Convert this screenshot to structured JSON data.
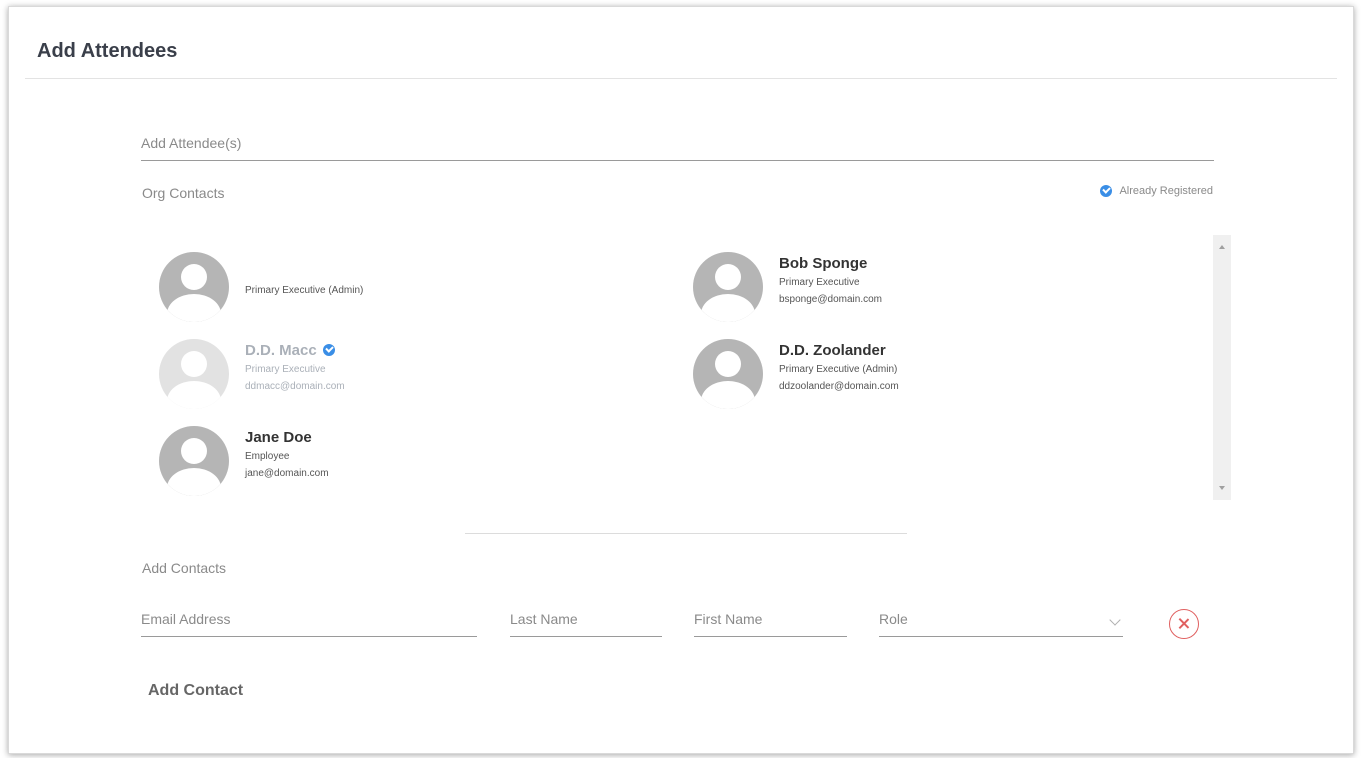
{
  "header": {
    "title": "Add Attendees"
  },
  "attendee_search": {
    "placeholder": "Add Attendee(s)"
  },
  "org_contacts": {
    "label": "Org Contacts",
    "legend_label": "Already Registered",
    "contacts": [
      {
        "name": "",
        "role": "Primary Executive (Admin)",
        "email": "",
        "registered": false
      },
      {
        "name": "Bob Sponge",
        "role": "Primary Executive",
        "email": "bsponge@domain.com",
        "registered": false
      },
      {
        "name": "D.D. Macc",
        "role": "Primary Executive",
        "email": "ddmacc@domain.com",
        "registered": true
      },
      {
        "name": "D.D. Zoolander",
        "role": "Primary Executive (Admin)",
        "email": "ddzoolander@domain.com",
        "registered": false
      },
      {
        "name": "Jane Doe",
        "role": "Employee",
        "email": "jane@domain.com",
        "registered": false
      }
    ]
  },
  "add_contacts": {
    "label": "Add Contacts",
    "email_placeholder": "Email Address",
    "last_name_placeholder": "Last Name",
    "first_name_placeholder": "First Name",
    "role_placeholder": "Role",
    "add_button_label": "Add Contact"
  },
  "colors": {
    "accent": "#3a8ee6",
    "remove": "#e06060",
    "avatar": "#b5b5b5"
  }
}
